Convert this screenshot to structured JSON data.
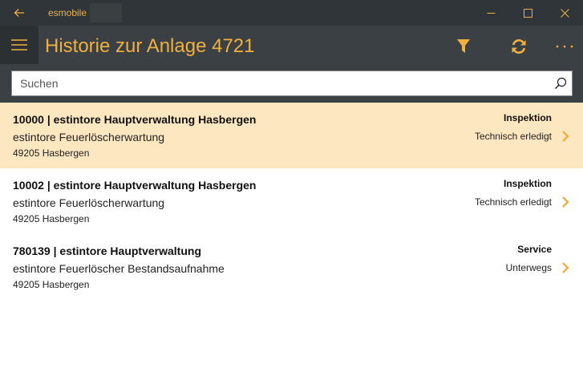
{
  "titlebar": {
    "app_name": "esmobile",
    "icons": {
      "back": "back-arrow-icon",
      "minimize": "minimize-icon",
      "maximize": "maximize-icon",
      "close": "close-icon"
    }
  },
  "appbar": {
    "title": "Historie zur Anlage 4721",
    "icons": {
      "menu": "hamburger-menu-icon",
      "filter": "filter-icon",
      "refresh": "refresh-icon",
      "more": "more-dots-icon"
    }
  },
  "search": {
    "placeholder": "Suchen",
    "value": "",
    "icon": "search-icon"
  },
  "colors": {
    "accent": "#f0b040",
    "titlebar": "#2f3538",
    "appbar": "#3a4043",
    "selected_row": "#fde7c0"
  },
  "items": [
    {
      "title": "10000  |  estintore Hauptverwaltung Hasbergen",
      "subtitle": "estintore Feuerlöscherwartung",
      "address": "49205 Hasbergen",
      "type": "Inspektion",
      "status": "Technisch erledigt",
      "selected": true
    },
    {
      "title": "10002  |  estintore Hauptverwaltung Hasbergen",
      "subtitle": "estintore Feuerlöscherwartung",
      "address": "49205 Hasbergen",
      "type": "Inspektion",
      "status": "Technisch erledigt",
      "selected": false
    },
    {
      "title": "780139  |  estintore Hauptverwaltung",
      "subtitle": "estintore Feuerlöscher Bestandsaufnahme",
      "address": "49205 Hasbergen",
      "type": "Service",
      "status": "Unterwegs",
      "selected": false
    }
  ]
}
